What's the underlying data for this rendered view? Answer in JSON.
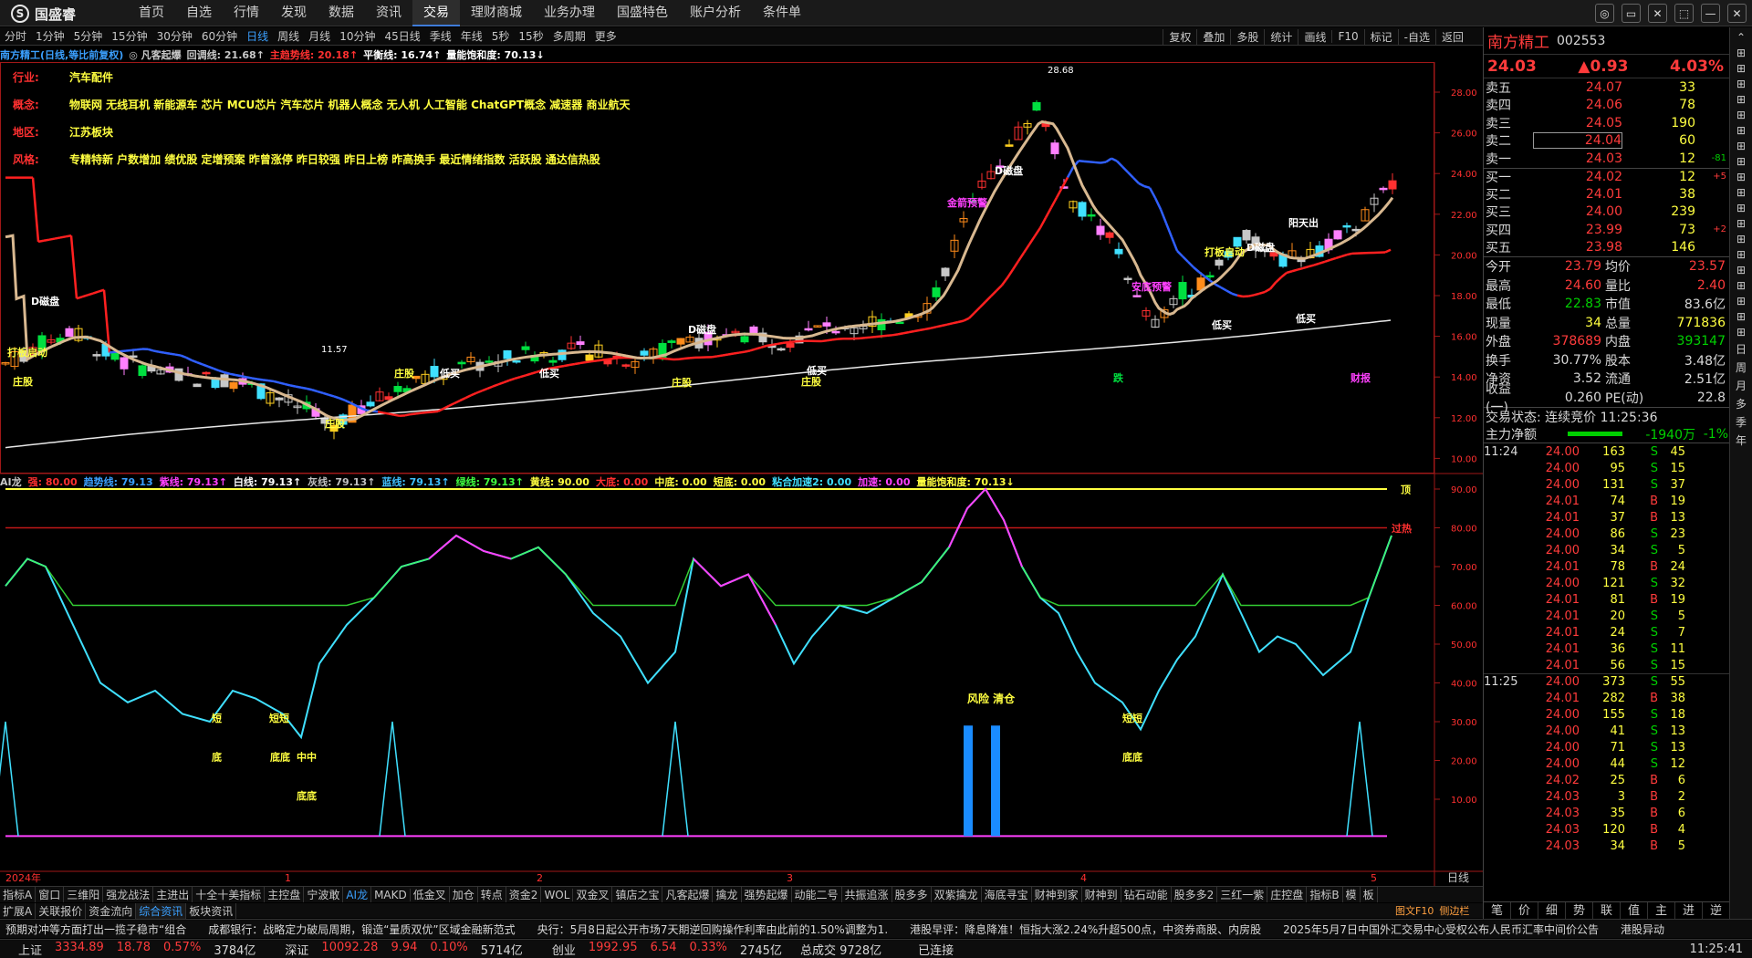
{
  "app": {
    "logo": "国盛睿",
    "logo_mark": "S"
  },
  "menu": [
    "首页",
    "自选",
    "行情",
    "发现",
    "数据",
    "资讯",
    "交易",
    "理财商城",
    "业务办理",
    "国盛特色",
    "账户分析",
    "条件单"
  ],
  "menu_active": "交易",
  "window_buttons": [
    "◎",
    "▭",
    "✕",
    "⬚",
    "—",
    "✕"
  ],
  "periods": [
    "分时",
    "1分钟",
    "5分钟",
    "15分钟",
    "30分钟",
    "60分钟",
    "日线",
    "周线",
    "月线",
    "10分钟",
    "45日线",
    "季线",
    "年线",
    "5秒",
    "15秒",
    "多周期",
    "更多"
  ],
  "period_active": "日线",
  "tools": [
    "复权",
    "叠加",
    "多股",
    "统计",
    "画线",
    "F10",
    "标记",
    "-自选",
    "返回"
  ],
  "main_indicators": [
    {
      "t": "南方精工(日线,等比前复权)",
      "c": "#3ba0ff"
    },
    {
      "t": "◎ 凡客起爆",
      "c": "#c8c8c8"
    },
    {
      "t": "回调线: 21.68↑",
      "c": "#c8c8c8"
    },
    {
      "t": "主趋势线: 20.18↑",
      "c": "#ff3030"
    },
    {
      "t": "平衡线: 16.74↑",
      "c": "#ffffff"
    },
    {
      "t": "量能饱和度: 70.13↓",
      "c": "#ffffff"
    }
  ],
  "stock_info": [
    {
      "k": "行业:",
      "v": "汽车配件"
    },
    {
      "k": "概念:",
      "v": "物联网 无线耳机 新能源车 芯片 MCU芯片 汽车芯片 机器人概念 无人机 人工智能 ChatGPT概念 减速器 商业航天"
    },
    {
      "k": "地区:",
      "v": "江苏板块"
    },
    {
      "k": "风格:",
      "v": "专精特新 户数增加 绩优股 定增预案 昨曾涨停 昨日较强 昨日上榜 昨高换手 最近情绪指数 活跃股 通达信热股"
    }
  ],
  "price_axis": [
    "28.00",
    "26.00",
    "24.00",
    "22.00",
    "20.00",
    "18.00",
    "16.00",
    "14.00",
    "12.00",
    "10.00"
  ],
  "peak_label": "28.68",
  "low_label": "11.57",
  "chart_marks": {
    "dcp": "D磁盘",
    "lowbuy": "低买",
    "zhuang": "庄股",
    "startup": "打板启动",
    "yangtian": "阳天出",
    "dabang": "打板启动",
    "jinjian": "金箭预警",
    "anjian": "安底预警",
    "die": "跌",
    "caibao": "财报"
  },
  "ai_indicators": [
    {
      "t": "AI龙",
      "c": "#c8c8c8"
    },
    {
      "t": "强: 80.00",
      "c": "#ff3030"
    },
    {
      "t": "趋势线: 79.13",
      "c": "#3ba0ff"
    },
    {
      "t": "紫线: 79.13↑",
      "c": "#ff40ff"
    },
    {
      "t": "白线: 79.13↑",
      "c": "#ffffff"
    },
    {
      "t": "灰线: 79.13↑",
      "c": "#c0c0c0"
    },
    {
      "t": "蓝线: 79.13↑",
      "c": "#40c0ff"
    },
    {
      "t": "绿线: 79.13↑",
      "c": "#40ff40"
    },
    {
      "t": "黄线: 90.00",
      "c": "#ffff40"
    },
    {
      "t": "大底: 0.00",
      "c": "#ff3030"
    },
    {
      "t": "中底: 0.00",
      "c": "#ffff40"
    },
    {
      "t": "短底: 0.00",
      "c": "#ffff40"
    },
    {
      "t": "粘合加速2: 0.00",
      "c": "#40e0ff"
    },
    {
      "t": "加速: 0.00",
      "c": "#ff40ff"
    },
    {
      "t": "量能饱和度: 70.13↓",
      "c": "#ffff40"
    }
  ],
  "ai_axis": [
    "90.00",
    "80.00",
    "70.00",
    "60.00",
    "50.00",
    "40.00",
    "30.00",
    "20.00",
    "10.00"
  ],
  "ai_marks": {
    "top": "顶",
    "overheat": "过热",
    "risk": "风险 清仓",
    "short": "短",
    "bottom": "底",
    "short_short": "短短",
    "bottom2": "底底",
    "mid": "中中",
    "short2": "短"
  },
  "time_axis": [
    "2024年",
    "1",
    "2",
    "3",
    "4",
    "5"
  ],
  "time_label": "日线",
  "bottom_tabs": [
    "指标A",
    "窗口",
    "三维阳",
    "强龙战法",
    "主进出",
    "十全十美指标",
    "主控盘",
    "宁波敢",
    "AI龙",
    "MAKD",
    "低金叉",
    "加仓",
    "转点",
    "资金2",
    "WOL",
    "双金叉",
    "镇店之宝",
    "凡客起爆",
    "擒龙",
    "强势起爆",
    "动能二号",
    "共振追涨",
    "股多多",
    "双紫擒龙",
    "海底寻宝",
    "财神到家",
    "财神到",
    "钻石动能",
    "股多多2",
    "三红一紫",
    "庄控盘",
    "指标B",
    "模",
    "板"
  ],
  "bottom_tab_active": "AI龙",
  "bottom_tabs2": [
    "扩展A",
    "关联报价",
    "资金流向",
    "综合资讯",
    "板块资讯"
  ],
  "bottom_tab2_active": "综合资讯",
  "quote_tabs": [
    "图文F10",
    "侧边栏"
  ],
  "stock": {
    "name": "南方精工",
    "code": "002553",
    "price": "24.03",
    "change": "▲0.93",
    "pct": "4.03%"
  },
  "order_book": [
    {
      "l": "卖五",
      "p": "24.07",
      "v": "33",
      "c": "",
      "pc": "#ff3b3b"
    },
    {
      "l": "卖四",
      "p": "24.06",
      "v": "78",
      "c": "",
      "pc": "#ff3b3b"
    },
    {
      "l": "卖三",
      "p": "24.05",
      "v": "190",
      "c": "",
      "pc": "#ff3b3b"
    },
    {
      "l": "卖二",
      "p": "24.04",
      "v": "60",
      "c": "",
      "pc": "#ff3b3b"
    },
    {
      "l": "卖一",
      "p": "24.03",
      "v": "12",
      "c": "-81",
      "pc": "#ff3b3b"
    },
    {
      "l": "买一",
      "p": "24.02",
      "v": "12",
      "c": "+5",
      "pc": "#ff3b3b"
    },
    {
      "l": "买二",
      "p": "24.01",
      "v": "38",
      "c": "",
      "pc": "#ff3b3b"
    },
    {
      "l": "买三",
      "p": "24.00",
      "v": "239",
      "c": "",
      "pc": "#ff3b3b"
    },
    {
      "l": "买四",
      "p": "23.99",
      "v": "73",
      "c": "+2",
      "pc": "#ff3b3b"
    },
    {
      "l": "买五",
      "p": "23.98",
      "v": "146",
      "c": "",
      "pc": "#ff3b3b"
    }
  ],
  "stats": [
    {
      "a": "今开",
      "b": "23.79",
      "bc": "#ff3b3b",
      "c": "均价",
      "d": "23.57",
      "dc": "#ff3b3b"
    },
    {
      "a": "最高",
      "b": "24.60",
      "bc": "#ff3b3b",
      "c": "量比",
      "d": "2.40",
      "dc": "#ff3b3b"
    },
    {
      "a": "最低",
      "b": "22.83",
      "bc": "#00d000",
      "c": "市值",
      "d": "83.6亿",
      "dc": "#d8d8d8"
    },
    {
      "a": "现量",
      "b": "34",
      "bc": "#ffff40",
      "c": "总量",
      "d": "771836",
      "dc": "#ffff40"
    },
    {
      "a": "外盘",
      "b": "378689",
      "bc": "#ff3b3b",
      "c": "内盘",
      "d": "393147",
      "dc": "#00d000"
    },
    {
      "a": "换手",
      "b": "30.77%",
      "bc": "#d8d8d8",
      "c": "股本",
      "d": "3.48亿",
      "dc": "#d8d8d8"
    },
    {
      "a": "净资",
      "b": "3.52",
      "bc": "#d8d8d8",
      "c": "流通",
      "d": "2.51亿",
      "dc": "#d8d8d8"
    },
    {
      "a": "收益(一)",
      "b": "0.260",
      "bc": "#d8d8d8",
      "c": "PE(动)",
      "d": "22.8",
      "dc": "#d8d8d8"
    }
  ],
  "trade_status": "交易状态: 连续竞价 11:25:36",
  "main_flow": {
    "label": "主力净额",
    "value": "-1940万",
    "pct": "-1%"
  },
  "ticks_time1": "11:24",
  "ticks_time2": "11:25",
  "ticks": [
    {
      "p": "24.00",
      "v": "163",
      "s": "S",
      "n": "45"
    },
    {
      "p": "24.00",
      "v": "95",
      "s": "S",
      "n": "15"
    },
    {
      "p": "24.00",
      "v": "131",
      "s": "S",
      "n": "37"
    },
    {
      "p": "24.01",
      "v": "74",
      "s": "B",
      "n": "19"
    },
    {
      "p": "24.01",
      "v": "37",
      "s": "B",
      "n": "13"
    },
    {
      "p": "24.00",
      "v": "86",
      "s": "S",
      "n": "23"
    },
    {
      "p": "24.00",
      "v": "34",
      "s": "S",
      "n": "5"
    },
    {
      "p": "24.01",
      "v": "78",
      "s": "B",
      "n": "24"
    },
    {
      "p": "24.00",
      "v": "121",
      "s": "S",
      "n": "32"
    },
    {
      "p": "24.01",
      "v": "81",
      "s": "B",
      "n": "19"
    },
    {
      "p": "24.01",
      "v": "20",
      "s": "S",
      "n": "5"
    },
    {
      "p": "24.01",
      "v": "24",
      "s": "S",
      "n": "7"
    },
    {
      "p": "24.01",
      "v": "36",
      "s": "S",
      "n": "11"
    },
    {
      "p": "24.01",
      "v": "56",
      "s": "S",
      "n": "15"
    },
    {
      "p": "24.00",
      "v": "373",
      "s": "S",
      "n": "55"
    },
    {
      "p": "24.01",
      "v": "282",
      "s": "B",
      "n": "38"
    },
    {
      "p": "24.00",
      "v": "155",
      "s": "S",
      "n": "18"
    },
    {
      "p": "24.00",
      "v": "41",
      "s": "S",
      "n": "13"
    },
    {
      "p": "24.00",
      "v": "71",
      "s": "S",
      "n": "13"
    },
    {
      "p": "24.00",
      "v": "44",
      "s": "S",
      "n": "12"
    },
    {
      "p": "24.02",
      "v": "25",
      "s": "B",
      "n": "6"
    },
    {
      "p": "24.03",
      "v": "3",
      "s": "B",
      "n": "2"
    },
    {
      "p": "24.03",
      "v": "35",
      "s": "B",
      "n": "6"
    },
    {
      "p": "24.03",
      "v": "120",
      "s": "B",
      "n": "4"
    },
    {
      "p": "24.03",
      "v": "34",
      "s": "B",
      "n": "5"
    }
  ],
  "rp_tabs": [
    "笔",
    "价",
    "细",
    "势",
    "联",
    "值",
    "主",
    "进",
    "逆"
  ],
  "side_tabs": [
    "⌃",
    "⊞",
    "⊞",
    "⊞",
    "⊞",
    "⊞",
    "⊞",
    "⊞",
    "⊞",
    "⊞",
    "⊞",
    "⊞",
    "⊞",
    "⊞",
    "⊞",
    "⊞",
    "⊞",
    "⊞",
    "⊞",
    "⊞",
    "日",
    "周",
    "月",
    "多",
    "季",
    "年"
  ],
  "news": [
    "预期对冲等方面打出一揽子稳市“组合",
    "成都银行：战略定力破局周期，锻造“量质双优”区域金融新范式",
    "央行：5月8日起公开市场7天期逆回购操作利率由此前的1.50%调整为1.",
    "港股早评：降息降准！恒指大涨2.24%升超500点，中资券商股、内房股",
    "2025年5月7日中国外汇交易中心受权公布人民币汇率中间价公告",
    "港股异动"
  ],
  "index_status": [
    {
      "n": "上证",
      "v": "3334.89",
      "c": "18.78",
      "p": "0.57%",
      "a": "3784亿"
    },
    {
      "n": "深证",
      "v": "10092.28",
      "c": "9.94",
      "p": "0.10%",
      "a": "5714亿"
    },
    {
      "n": "创业",
      "v": "1992.95",
      "c": "6.54",
      "p": "0.33%",
      "a": "2745亿"
    }
  ],
  "total_turnover": "总成交 9728亿",
  "connection": "已连接",
  "clock": "11:25:41",
  "colors": {
    "up": "#ff3b3b",
    "down": "#00d000",
    "yellow": "#ffff40",
    "blue": "#3ba0ff"
  }
}
